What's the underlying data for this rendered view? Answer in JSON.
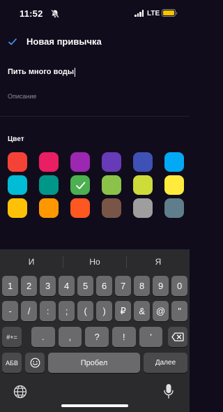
{
  "status_bar": {
    "time": "11:52",
    "network": "LTE"
  },
  "header": {
    "title": "Новая привычка"
  },
  "form": {
    "name_value": "Пить много воды",
    "description_placeholder": "Описание"
  },
  "colors": {
    "label": "Цвет",
    "selected_index": 8,
    "swatches": [
      "#f44336",
      "#e91e63",
      "#9c27b0",
      "#673ab7",
      "#3f51b5",
      "#03a9f4",
      "#00bcd4",
      "#009688",
      "#4caf50",
      "#8bc34a",
      "#cddc39",
      "#ffeb3b",
      "#ffc107",
      "#ff9800",
      "#ff5722",
      "#795548",
      "#9e9e9e",
      "#607d8b"
    ]
  },
  "keyboard": {
    "suggestions": [
      "И",
      "Но",
      "Я"
    ],
    "row1": [
      "1",
      "2",
      "3",
      "4",
      "5",
      "6",
      "7",
      "8",
      "9",
      "0"
    ],
    "row2": [
      "-",
      "/",
      ":",
      ";",
      "(",
      ")",
      "₽",
      "&",
      "@",
      "\""
    ],
    "symbols_key": "#+=",
    "row3": [
      ".",
      ",",
      "?",
      "!",
      "'"
    ],
    "abc_key": "АБВ",
    "space_key": "Пробел",
    "return_key": "Далее"
  }
}
